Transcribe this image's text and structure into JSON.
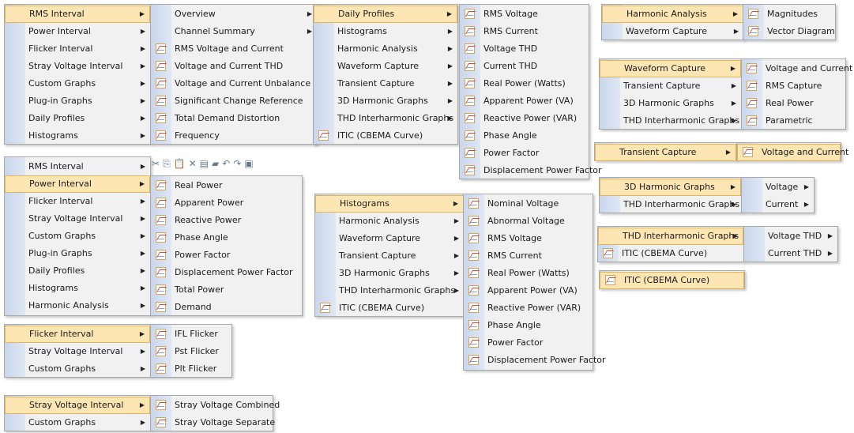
{
  "menus": {
    "main_a": [
      "RMS Interval",
      "Power Interval",
      "Flicker Interval",
      "Stray Voltage Interval",
      "Custom Graphs",
      "Plug-in Graphs",
      "Daily Profiles",
      "Histograms"
    ],
    "rms_sub": [
      "Overview",
      "Channel Summary",
      "RMS Voltage and Current",
      "Voltage and Current THD",
      "Voltage and Current Unbalance",
      "Significant Change Reference",
      "Total Demand Distortion",
      "Frequency"
    ],
    "daily_sub": [
      "Daily Profiles",
      "Histograms",
      "Harmonic Analysis",
      "Waveform Capture",
      "Transient Capture",
      "3D Harmonic Graphs",
      "THD Interharmonic Graphs",
      "ITIC (CBEMA Curve)"
    ],
    "daily_values": [
      "RMS Voltage",
      "RMS Current",
      "Voltage THD",
      "Current THD",
      "Real Power (Watts)",
      "Apparent Power (VA)",
      "Reactive Power (VAR)",
      "Phase Angle",
      "Power Factor",
      "Displacement Power Factor"
    ],
    "harmonic_sub": [
      "Harmonic Analysis",
      "Waveform Capture"
    ],
    "harmonic_values": [
      "Magnitudes",
      "Vector Diagram"
    ],
    "waveform_sub": [
      "Waveform Capture",
      "Transient Capture",
      "3D Harmonic Graphs",
      "THD Interharmonic Graphs"
    ],
    "waveform_values": [
      "Voltage and Current",
      "RMS Capture",
      "Real Power",
      "Parametric"
    ],
    "transient_sub": [
      "Transient Capture"
    ],
    "transient_values": [
      "Voltage and Current"
    ],
    "h3d_sub": [
      "3D Harmonic Graphs",
      "THD Interharmonic Graphs"
    ],
    "h3d_values": [
      "Voltage",
      "Current"
    ],
    "thd_sub": [
      "THD Interharmonic Graphs",
      "ITIC (CBEMA Curve)"
    ],
    "thd_values": [
      "Voltage THD",
      "Current THD"
    ],
    "itic_single": [
      "ITIC (CBEMA Curve)"
    ],
    "main_b": [
      "RMS Interval",
      "Power Interval",
      "Flicker Interval",
      "Stray Voltage Interval",
      "Custom Graphs",
      "Plug-in Graphs",
      "Daily Profiles",
      "Histograms",
      "Harmonic Analysis"
    ],
    "power_values": [
      "Real Power",
      "Apparent Power",
      "Reactive Power",
      "Phase Angle",
      "Power Factor",
      "Displacement Power Factor",
      "Total Power",
      "Demand"
    ],
    "hist_sub": [
      "Histograms",
      "Harmonic Analysis",
      "Waveform Capture",
      "Transient Capture",
      "3D Harmonic Graphs",
      "THD Interharmonic Graphs",
      "ITIC (CBEMA Curve)"
    ],
    "hist_values": [
      "Nominal Voltage",
      "Abnormal Voltage",
      "RMS Voltage",
      "RMS Current",
      "Real Power (Watts)",
      "Apparent Power (VA)",
      "Reactive Power (VAR)",
      "Phase Angle",
      "Power Factor",
      "Displacement Power Factor"
    ],
    "flicker_sub": [
      "Flicker Interval",
      "Stray Voltage Interval",
      "Custom Graphs"
    ],
    "flicker_values": [
      "IFL Flicker",
      "Pst Flicker",
      "Plt Flicker"
    ],
    "stray_sub": [
      "Stray Voltage Interval",
      "Custom Graphs"
    ],
    "stray_values": [
      "Stray Voltage Combined",
      "Stray Voltage Separate"
    ]
  },
  "toolbar_icons": [
    "cut-icon",
    "copy-icon",
    "paste-icon",
    "delete-icon",
    "properties-icon",
    "folder-icon",
    "undo-icon",
    "redo-icon",
    "save-icon"
  ],
  "colors": {
    "highlight_fill": "#fde6b3",
    "highlight_border": "#e4b458",
    "menu_bg": "#f1f1f1",
    "gutter": "#c9d6ec"
  }
}
